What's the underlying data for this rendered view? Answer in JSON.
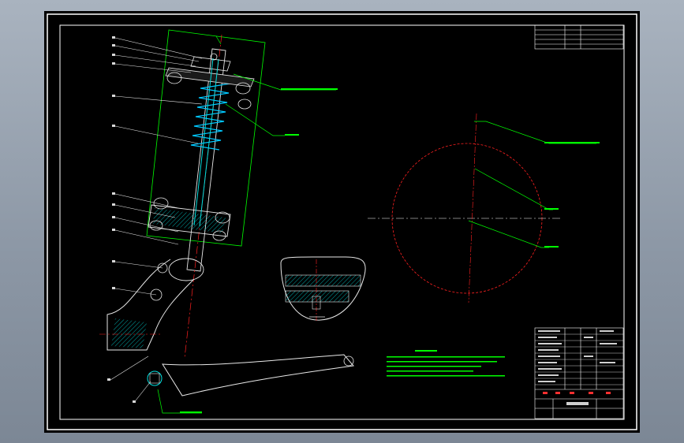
{
  "drawing": {
    "colors": {
      "background": "#000000",
      "frame": "#ffffff",
      "leader": "#00ff00",
      "section": "#ff0000",
      "hatch": "#00e0e0",
      "spring": "#00c8ff",
      "body": "#e8e8e8"
    },
    "title_block_label": "",
    "notes_heading": "",
    "leader_notes": [
      "",
      "",
      "",
      "",
      "",
      ""
    ]
  }
}
